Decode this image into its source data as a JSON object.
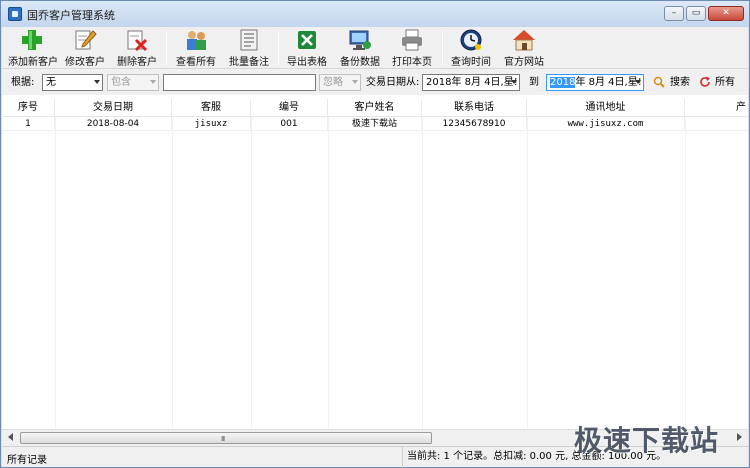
{
  "window": {
    "title": "国乔客户管理系统"
  },
  "toolbar": {
    "items": [
      {
        "label": "添加新客户",
        "icon": "add-customer-icon"
      },
      {
        "label": "修改客户",
        "icon": "edit-customer-icon"
      },
      {
        "label": "删除客户",
        "icon": "delete-customer-icon"
      },
      {
        "label": "查看所有",
        "icon": "view-all-icon"
      },
      {
        "label": "批量备注",
        "icon": "batch-note-icon"
      },
      {
        "label": "导出表格",
        "icon": "export-excel-icon"
      },
      {
        "label": "备份数据",
        "icon": "backup-data-icon"
      },
      {
        "label": "打印本页",
        "icon": "printer-icon"
      },
      {
        "label": "查询时间",
        "icon": "clock-icon"
      },
      {
        "label": "官方网站",
        "icon": "home-icon"
      }
    ]
  },
  "filter": {
    "by_label": "根据:",
    "field_value": "无",
    "match_value": "包含",
    "keyword_value": "",
    "ignore_value": "忽略",
    "date_from_label": "交易日期从:",
    "date_from_value": "2018年 8月 4日,星!",
    "date_to_label": "到",
    "date_to_year": "2018",
    "date_to_rest": "年 8月 4日,星!",
    "search_label": "搜索",
    "all_label": "所有"
  },
  "grid": {
    "columns": [
      "序号",
      "交易日期",
      "客服",
      "编号",
      "客户姓名",
      "联系电话",
      "通讯地址",
      "产"
    ],
    "rows": [
      [
        "1",
        "2018-08-04",
        "jisuxz",
        "001",
        "极速下载站",
        "12345678910",
        "www.jisuxz.com"
      ]
    ]
  },
  "scrollbar": {
    "grip": "III"
  },
  "status": {
    "left": "所有记录",
    "summary": "当前共: 1 个记录。总扣减: 0.00 元, 总金额: 100.00 元。"
  },
  "watermark": "极速下载站",
  "colors": {
    "title_bar": "#c3d6ee",
    "close_button": "#c8493a",
    "selection": "#3399ff"
  }
}
